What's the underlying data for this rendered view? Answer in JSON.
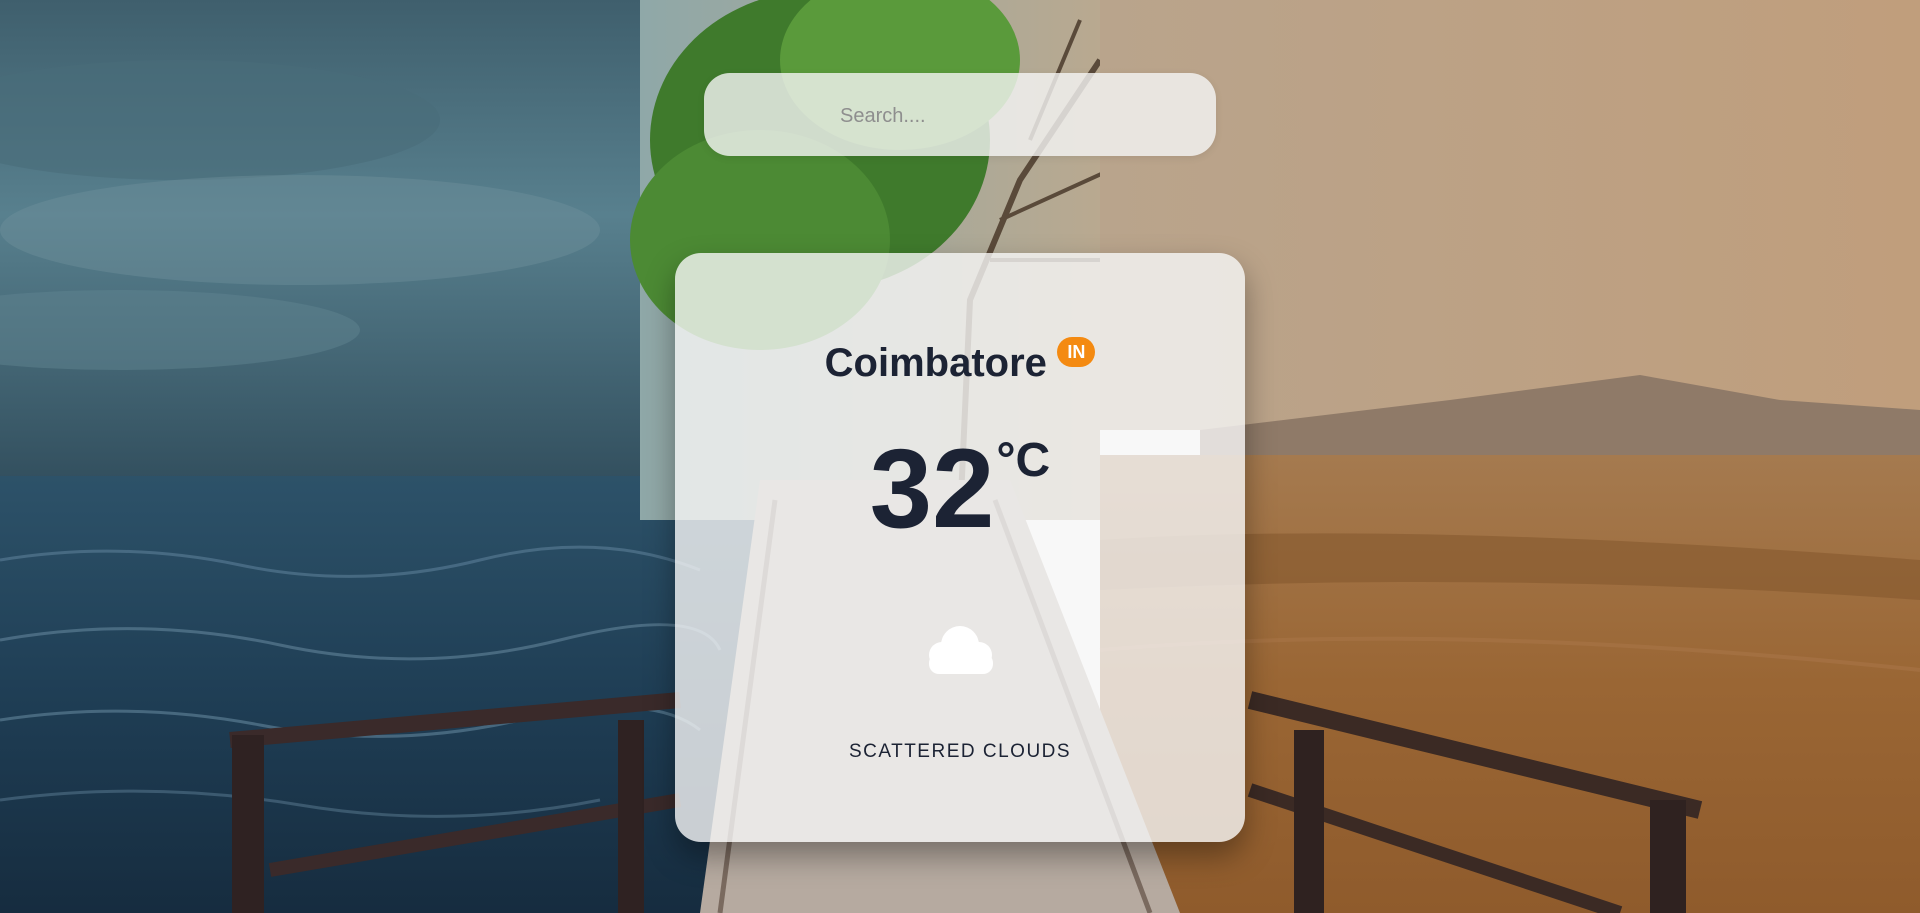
{
  "search": {
    "placeholder": "Search....",
    "value": ""
  },
  "weather": {
    "city": "Coimbatore",
    "country_code": "IN",
    "temperature": "32",
    "unit": "°C",
    "description": "SCATTERED CLOUDS",
    "icon": "cloud-icon"
  },
  "colors": {
    "badge": "#f48a11",
    "text": "#1c2334",
    "card": "#f6f6f6"
  }
}
